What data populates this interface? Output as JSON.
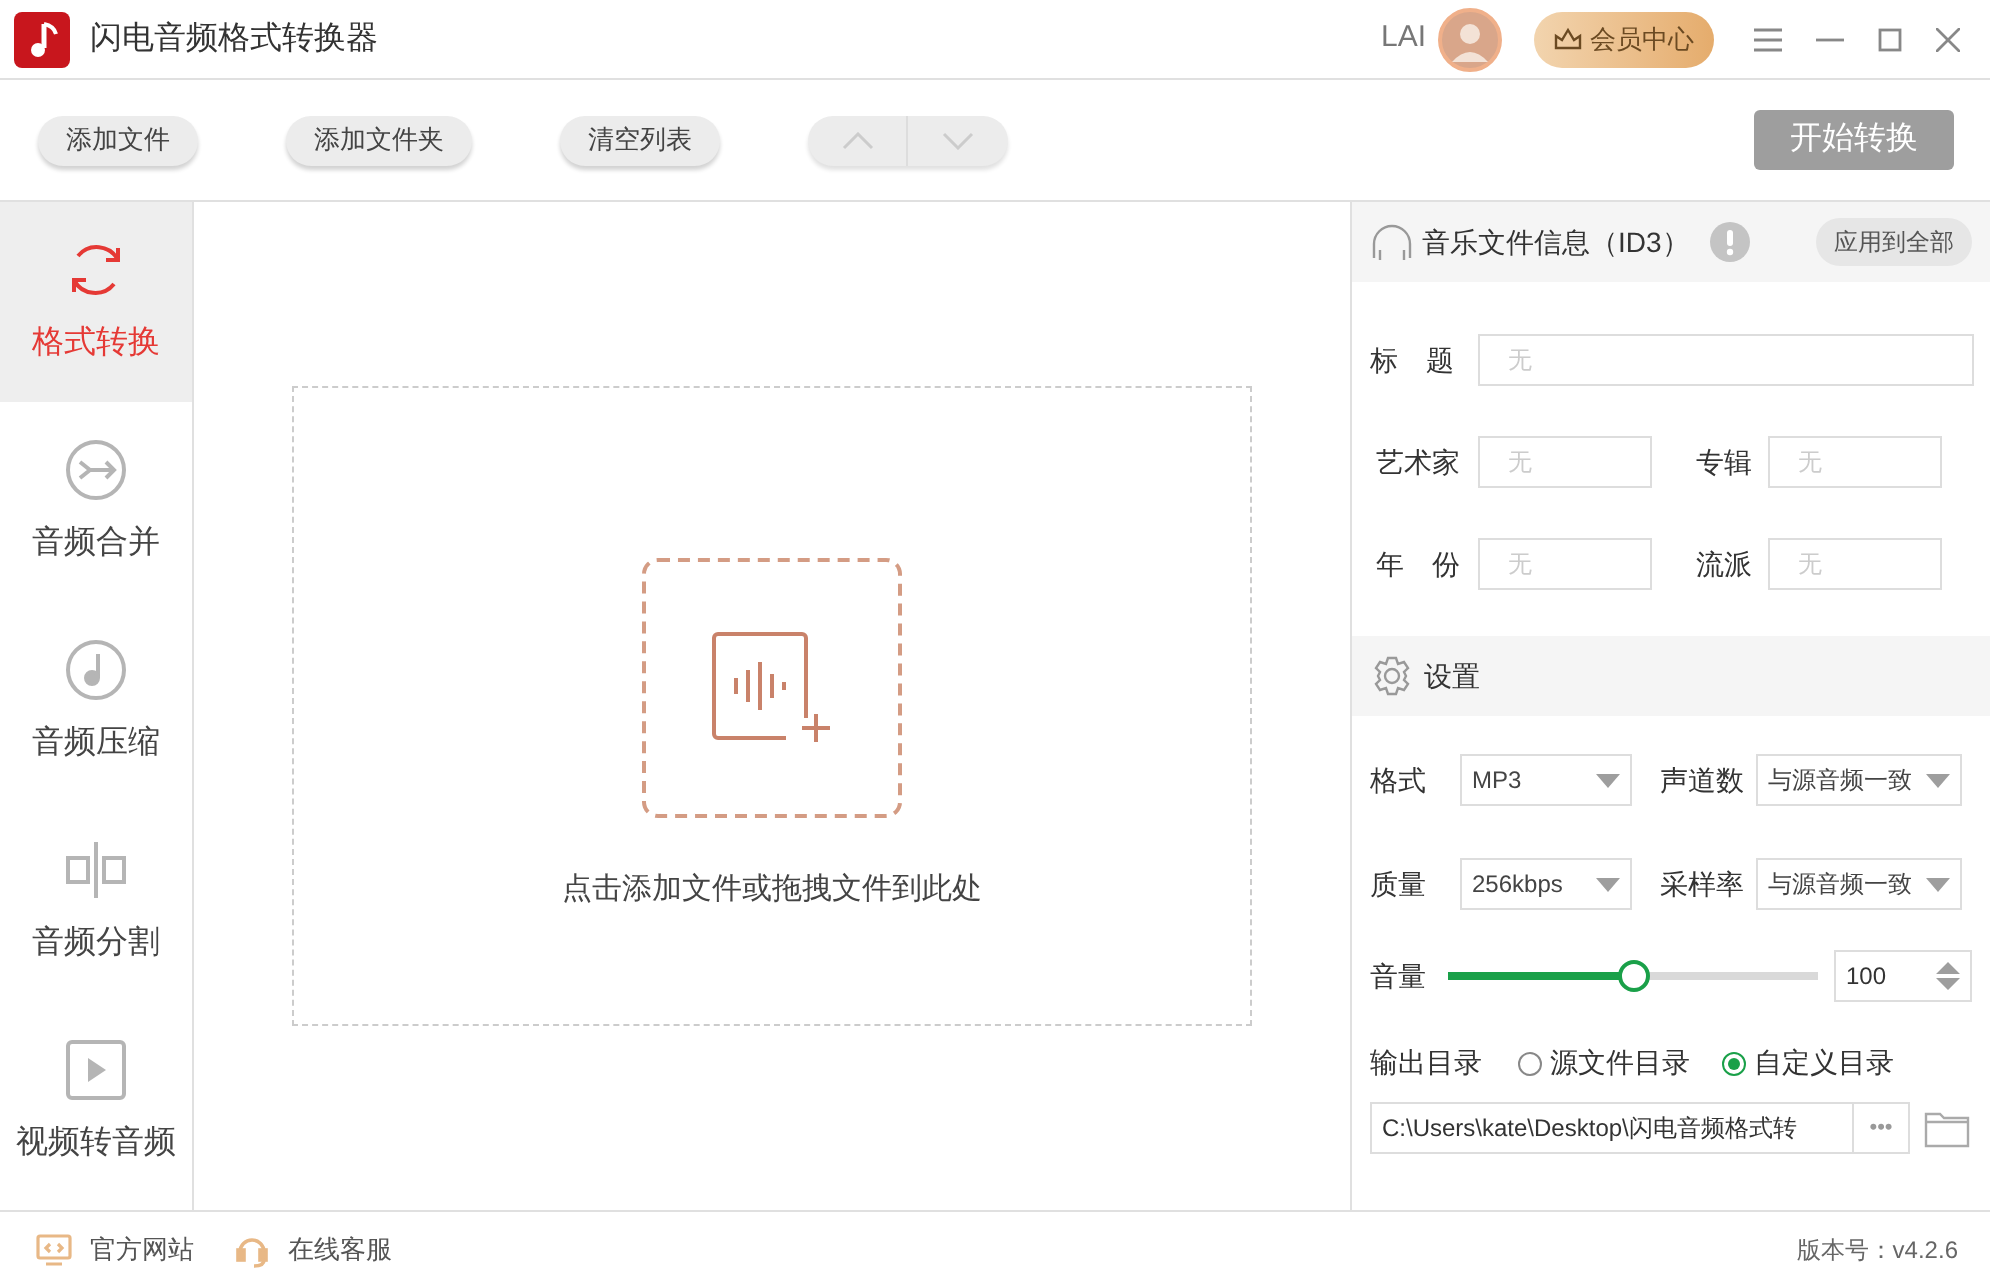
{
  "window": {
    "title": "闪电音频格式转换器",
    "user": "LAI",
    "vip_button": "会员中心"
  },
  "toolbar": {
    "buttons": [
      "添加文件",
      "添加文件夹",
      "清空列表"
    ],
    "start_button": "开始转换"
  },
  "sidebar": {
    "items": [
      {
        "label": "格式转换",
        "kind": "convert",
        "selected": true
      },
      {
        "label": "音频合并",
        "kind": "merge",
        "selected": false
      },
      {
        "label": "音频压缩",
        "kind": "compress",
        "selected": false
      },
      {
        "label": "音频分割",
        "kind": "split",
        "selected": false
      },
      {
        "label": "视频转音频",
        "kind": "video",
        "selected": false
      }
    ]
  },
  "drop_zone": {
    "hint": "点击添加文件或拖拽文件到此处"
  },
  "id3": {
    "title": "音乐文件信息（ID3）",
    "apply_button": "应用到全部",
    "fields": [
      {
        "label": "标　题",
        "placeholder": "无",
        "kind": "wide"
      },
      {
        "label": "艺术家",
        "placeholder": "无",
        "kind": "half"
      },
      {
        "label": "专辑",
        "placeholder": "无",
        "kind": "half"
      },
      {
        "label": "年　份",
        "placeholder": "无",
        "kind": "half"
      },
      {
        "label": "流派",
        "placeholder": "无",
        "kind": "half"
      }
    ]
  },
  "settings": {
    "title": "设置",
    "selects": [
      {
        "label": "格式",
        "value": "MP3"
      },
      {
        "label": "声道数",
        "value": "与源音频一致"
      },
      {
        "label": "质量",
        "value": "256kbps"
      },
      {
        "label": "采样率",
        "value": "与源音频一致"
      }
    ],
    "volume": {
      "label": "音量",
      "level": 0.5,
      "value": "100"
    },
    "output": {
      "label": "输出目录",
      "options": [
        {
          "label": "源文件目录",
          "selected": false
        },
        {
          "label": "自定义目录",
          "selected": true
        }
      ],
      "path": "C:\\Users\\kate\\Desktop\\闪电音频格式转",
      "more_button": "•••"
    }
  },
  "footer": {
    "links": [
      {
        "label": "官方网站",
        "kind": "website"
      },
      {
        "label": "在线客服",
        "kind": "support"
      }
    ],
    "version": "版本号：v4.2.6"
  }
}
